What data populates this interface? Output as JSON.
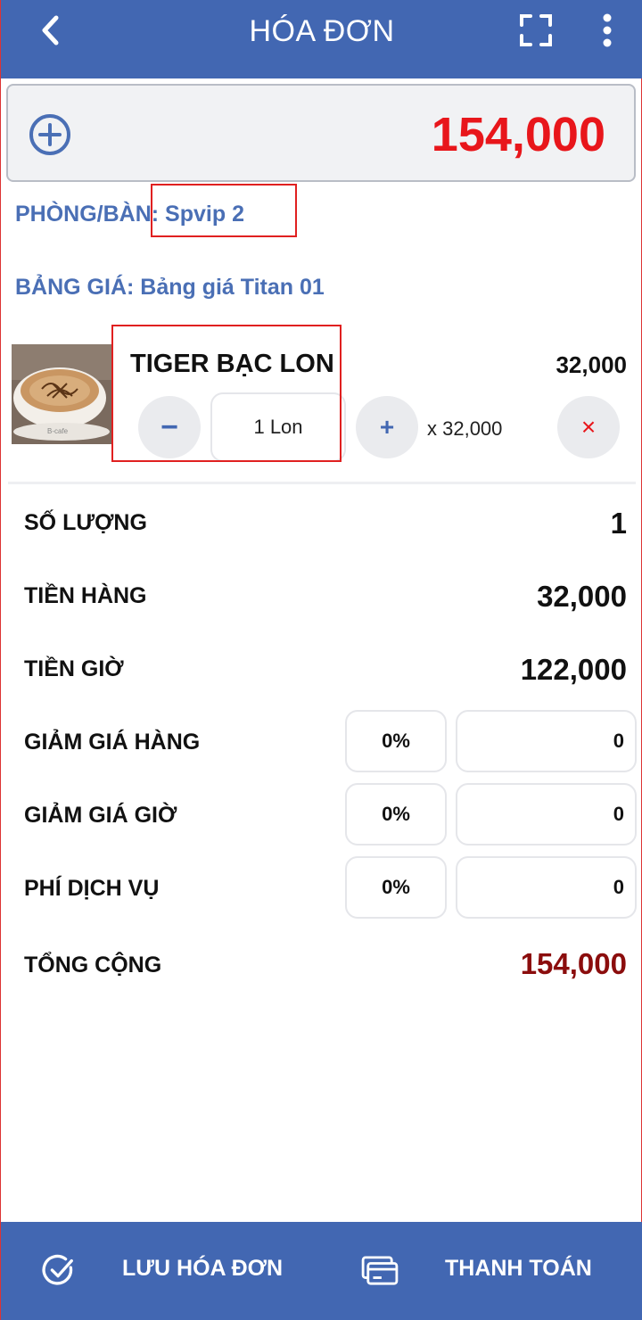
{
  "header": {
    "title": "HÓA ĐƠN"
  },
  "total_box": {
    "amount": "154,000"
  },
  "room": {
    "text": "PHÒNG/BÀN: Spvip 2"
  },
  "pricebook": {
    "text": "BẢNG GIÁ: Bảng giá Titan 01"
  },
  "item": {
    "name": "TIGER BẠC LON",
    "price": "32,000",
    "quantity_text": "1 Lon",
    "unit_price_text": "x 32,000",
    "minus_symbol": "−",
    "plus_symbol": "+",
    "remove_symbol": "×"
  },
  "summary": {
    "quantity_label": "SỐ LƯỢNG",
    "quantity_value": "1",
    "goods_label": "TIỀN HÀNG",
    "goods_value": "32,000",
    "time_label": "TIỀN GIỜ",
    "time_value": "122,000",
    "goods_discount_label": "GIẢM GIÁ HÀNG",
    "goods_discount_pct": "0%",
    "goods_discount_amount": "0",
    "time_discount_label": "GIẢM GIÁ GIỜ",
    "time_discount_pct": "0%",
    "time_discount_amount": "0",
    "service_fee_label": "PHÍ DỊCH VỤ",
    "service_fee_pct": "0%",
    "service_fee_amount": "0",
    "grand_total_label": "TỔNG CỘNG",
    "grand_total_value": "154,000"
  },
  "footer": {
    "save_label": "LƯU HÓA ĐƠN",
    "pay_label": "THANH TOÁN"
  },
  "colors": {
    "primary": "#4267b2",
    "total_red": "#e8161b",
    "grand_total": "#8b0d0d",
    "info_blue": "#4a6fb5"
  },
  "icons": [
    "back-arrow-icon",
    "fullscreen-icon",
    "more-vertical-icon",
    "add-circle-icon",
    "check-circle-icon",
    "payment-card-icon",
    "product-photo"
  ]
}
